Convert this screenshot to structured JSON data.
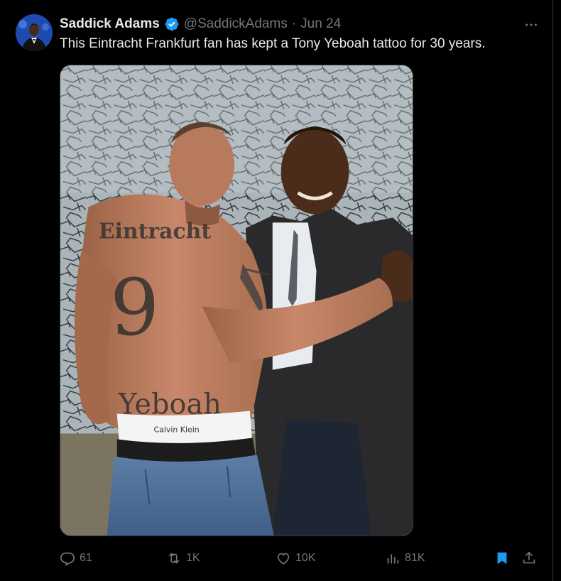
{
  "tweet": {
    "author_name": "Saddick Adams",
    "handle": "@SaddickAdams",
    "separator": "·",
    "date": "Jun 24",
    "text": "This Eintracht Frankfurt fan has kept a Tony Yeboah tattoo for 30 years.",
    "verified": true,
    "media": {
      "tattoo_text_top": "Eintracht",
      "tattoo_number": "9",
      "tattoo_text_bottom": "Yeboah",
      "waistband_text": "Calvin Klein"
    }
  },
  "actions": {
    "reply_count": "61",
    "retweet_count": "1K",
    "like_count": "10K",
    "view_count": "81K"
  },
  "icons": {
    "more": "more-horizontal-icon",
    "verified": "verified-badge-icon",
    "reply": "reply-icon",
    "retweet": "retweet-icon",
    "like": "heart-icon",
    "views": "views-chart-icon",
    "bookmark": "bookmark-icon",
    "share": "share-icon"
  },
  "colors": {
    "background": "#000000",
    "text": "#e7e9ea",
    "muted": "#71767b",
    "accent": "#1d9bf0",
    "border": "#2f3336"
  }
}
